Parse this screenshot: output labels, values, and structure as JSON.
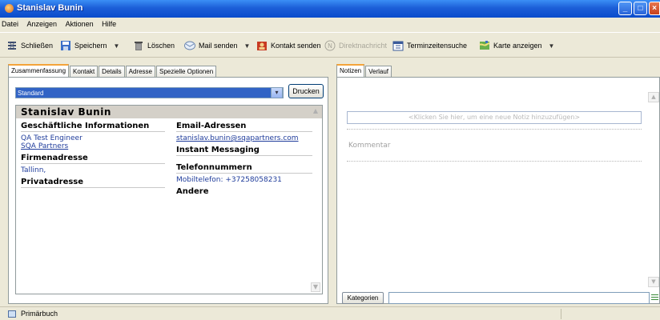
{
  "window": {
    "title": "Stanislav Bunin",
    "min": "_",
    "max": "□",
    "close": "×"
  },
  "menu": [
    "Datei",
    "Anzeigen",
    "Aktionen",
    "Hilfe"
  ],
  "toolbar": {
    "close_label": "Schließen",
    "save_label": "Speichern",
    "delete_label": "Löschen",
    "mail_label": "Mail senden",
    "send_contact_label": "Kontakt senden",
    "direct_message_label": "Direktnachricht",
    "schedule_label": "Terminzeitensuche",
    "map_label": "Karte anzeigen",
    "dropdown_glyph": "▼"
  },
  "left_tabs": [
    "Zusammenfassung",
    "Kontakt",
    "Details",
    "Adresse",
    "Spezielle Optionen"
  ],
  "view": {
    "selected": "Standard",
    "arrow": "▾",
    "print_label": "Drucken"
  },
  "contact": {
    "name": "Stanislav Bunin",
    "business_heading": "Geschäftliche Informationen",
    "job_title": "QA Test Engineer",
    "company": "SQA Partners",
    "work_address_heading": "Firmenadresse",
    "city": "Tallinn,",
    "home_address_heading": "Privatadresse",
    "email_heading": "Email-Adressen",
    "email": "stanislav.bunin@sqapartners.com",
    "im_heading": "Instant Messaging",
    "phone_heading": "Telefonnummern",
    "mobile_label": "Mobiltelefon:",
    "mobile_value": "+37258058231",
    "other_heading": "Andere"
  },
  "right_tabs": [
    "Notizen",
    "Verlauf"
  ],
  "notes": {
    "add_placeholder": "<Klicken Sie hier, um eine neue Notiz hinzuzufügen>",
    "comment_placeholder": "Kommentar",
    "categories_label": "Kategorien"
  },
  "status": {
    "text": "Primärbuch"
  },
  "colors": {
    "titlebar": "#0a4ccc",
    "selection": "#3163c5",
    "link": "#1f3c9b",
    "active_tab_accent": "#f4a43a"
  }
}
